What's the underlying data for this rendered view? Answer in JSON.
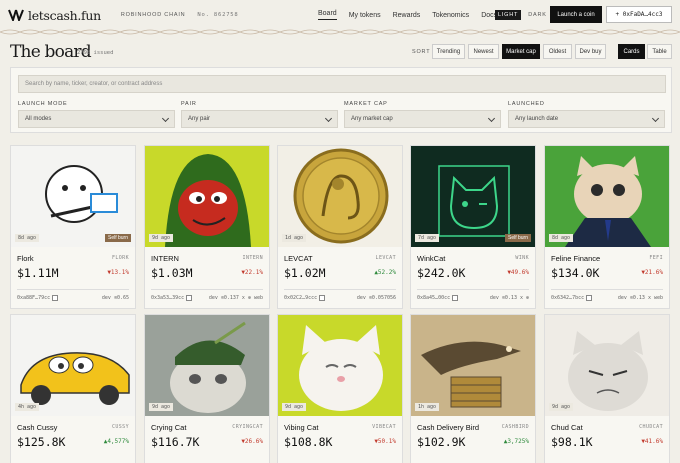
{
  "header": {
    "logo": "letscash.fun",
    "chain": "ROBINHOOD CHAIN",
    "block": "No. 862758",
    "nav": [
      "Board",
      "My tokens",
      "Rewards",
      "Tokenomics",
      "Docs"
    ],
    "theme_light": "LIGHT",
    "theme_dark": "DARK",
    "launch_label": "Launch a coin",
    "wallet_label": "+ 0xFaDA…4cc3"
  },
  "board": {
    "title": "The board",
    "issued": "2798 issued",
    "sort_label": "SORT",
    "sort_options": [
      "Trending",
      "Newest",
      "Market cap",
      "Oldest",
      "Dev buy"
    ],
    "active_sort": "Market cap",
    "view_options": [
      "Cards",
      "Table"
    ],
    "active_view": "Cards"
  },
  "filters": {
    "search_placeholder": "Search by name, ticker, creator, or contract address",
    "launch_mode": {
      "label": "LAUNCH MODE",
      "value": "All modes"
    },
    "pair": {
      "label": "PAIR",
      "value": "Any pair"
    },
    "market_cap": {
      "label": "MARKET CAP",
      "value": "Any market cap"
    },
    "launched": {
      "label": "LAUNCHED",
      "value": "Any launch date"
    }
  },
  "cards": [
    {
      "name": "Flork",
      "ticker": "FLORK",
      "price": "$1.11M",
      "change": "▼13.1%",
      "dir": "down",
      "age": "8d ago",
      "badge": "Self burn",
      "addr": "0xa88F…79cc",
      "dev": "dev ≋0.65",
      "bg": "#f4f4f2"
    },
    {
      "name": "INTERN",
      "ticker": "INTERN",
      "price": "$1.03M",
      "change": "▼22.1%",
      "dir": "down",
      "age": "9d ago",
      "badge": "",
      "addr": "0x3a53…39cc",
      "dev": "dev ≋0.137 x ⊕ web",
      "bg": "#c8d92a"
    },
    {
      "name": "LEVCAT",
      "ticker": "LEVCAT",
      "price": "$1.02M",
      "change": "▲52.2%",
      "dir": "up",
      "age": "1d ago",
      "badge": "",
      "addr": "0x02C2…9ccc",
      "dev": "dev ≋0.057056",
      "bg": "#f2efe6"
    },
    {
      "name": "WinkCat",
      "ticker": "WINK",
      "price": "$242.0K",
      "change": "▼49.6%",
      "dir": "down",
      "age": "7d ago",
      "badge": "Self burn",
      "addr": "0x8a45…00cc",
      "dev": "dev ≋0.13 x ⊕",
      "bg": "#0f2b20"
    },
    {
      "name": "Feline Finance",
      "ticker": "FEFI",
      "price": "$134.0K",
      "change": "▼21.6%",
      "dir": "down",
      "age": "8d ago",
      "badge": "",
      "addr": "0x6342…7bcc",
      "dev": "dev ≋0.13 x web",
      "bg": "#3b8f2e"
    },
    {
      "name": "Cash Cussy",
      "ticker": "CUSSY",
      "price": "$125.8K",
      "change": "▲4,577%",
      "dir": "up",
      "age": "4h ago",
      "badge": "",
      "addr": "",
      "dev": "",
      "bg": "#f4f4f2"
    },
    {
      "name": "Crying Cat",
      "ticker": "CRYINGCAT",
      "price": "$116.7K",
      "change": "▼26.6%",
      "dir": "down",
      "age": "9d ago",
      "badge": "",
      "addr": "",
      "dev": "",
      "bg": "#d8d4cc"
    },
    {
      "name": "Vibing Cat",
      "ticker": "VIBECAT",
      "price": "$108.8K",
      "change": "▼50.1%",
      "dir": "down",
      "age": "9d ago",
      "badge": "",
      "addr": "",
      "dev": "",
      "bg": "#c8d92a"
    },
    {
      "name": "Cash Delivery Bird",
      "ticker": "CASHBIRD",
      "price": "$102.9K",
      "change": "▲3,725%",
      "dir": "up",
      "age": "1h ago",
      "badge": "",
      "addr": "",
      "dev": "",
      "bg": "#c9b48a"
    },
    {
      "name": "Chud Cat",
      "ticker": "CHUDCAT",
      "price": "$98.1K",
      "change": "▼41.6%",
      "dir": "down",
      "age": "9d ago",
      "badge": "",
      "addr": "",
      "dev": "",
      "bg": "#efece6"
    }
  ]
}
